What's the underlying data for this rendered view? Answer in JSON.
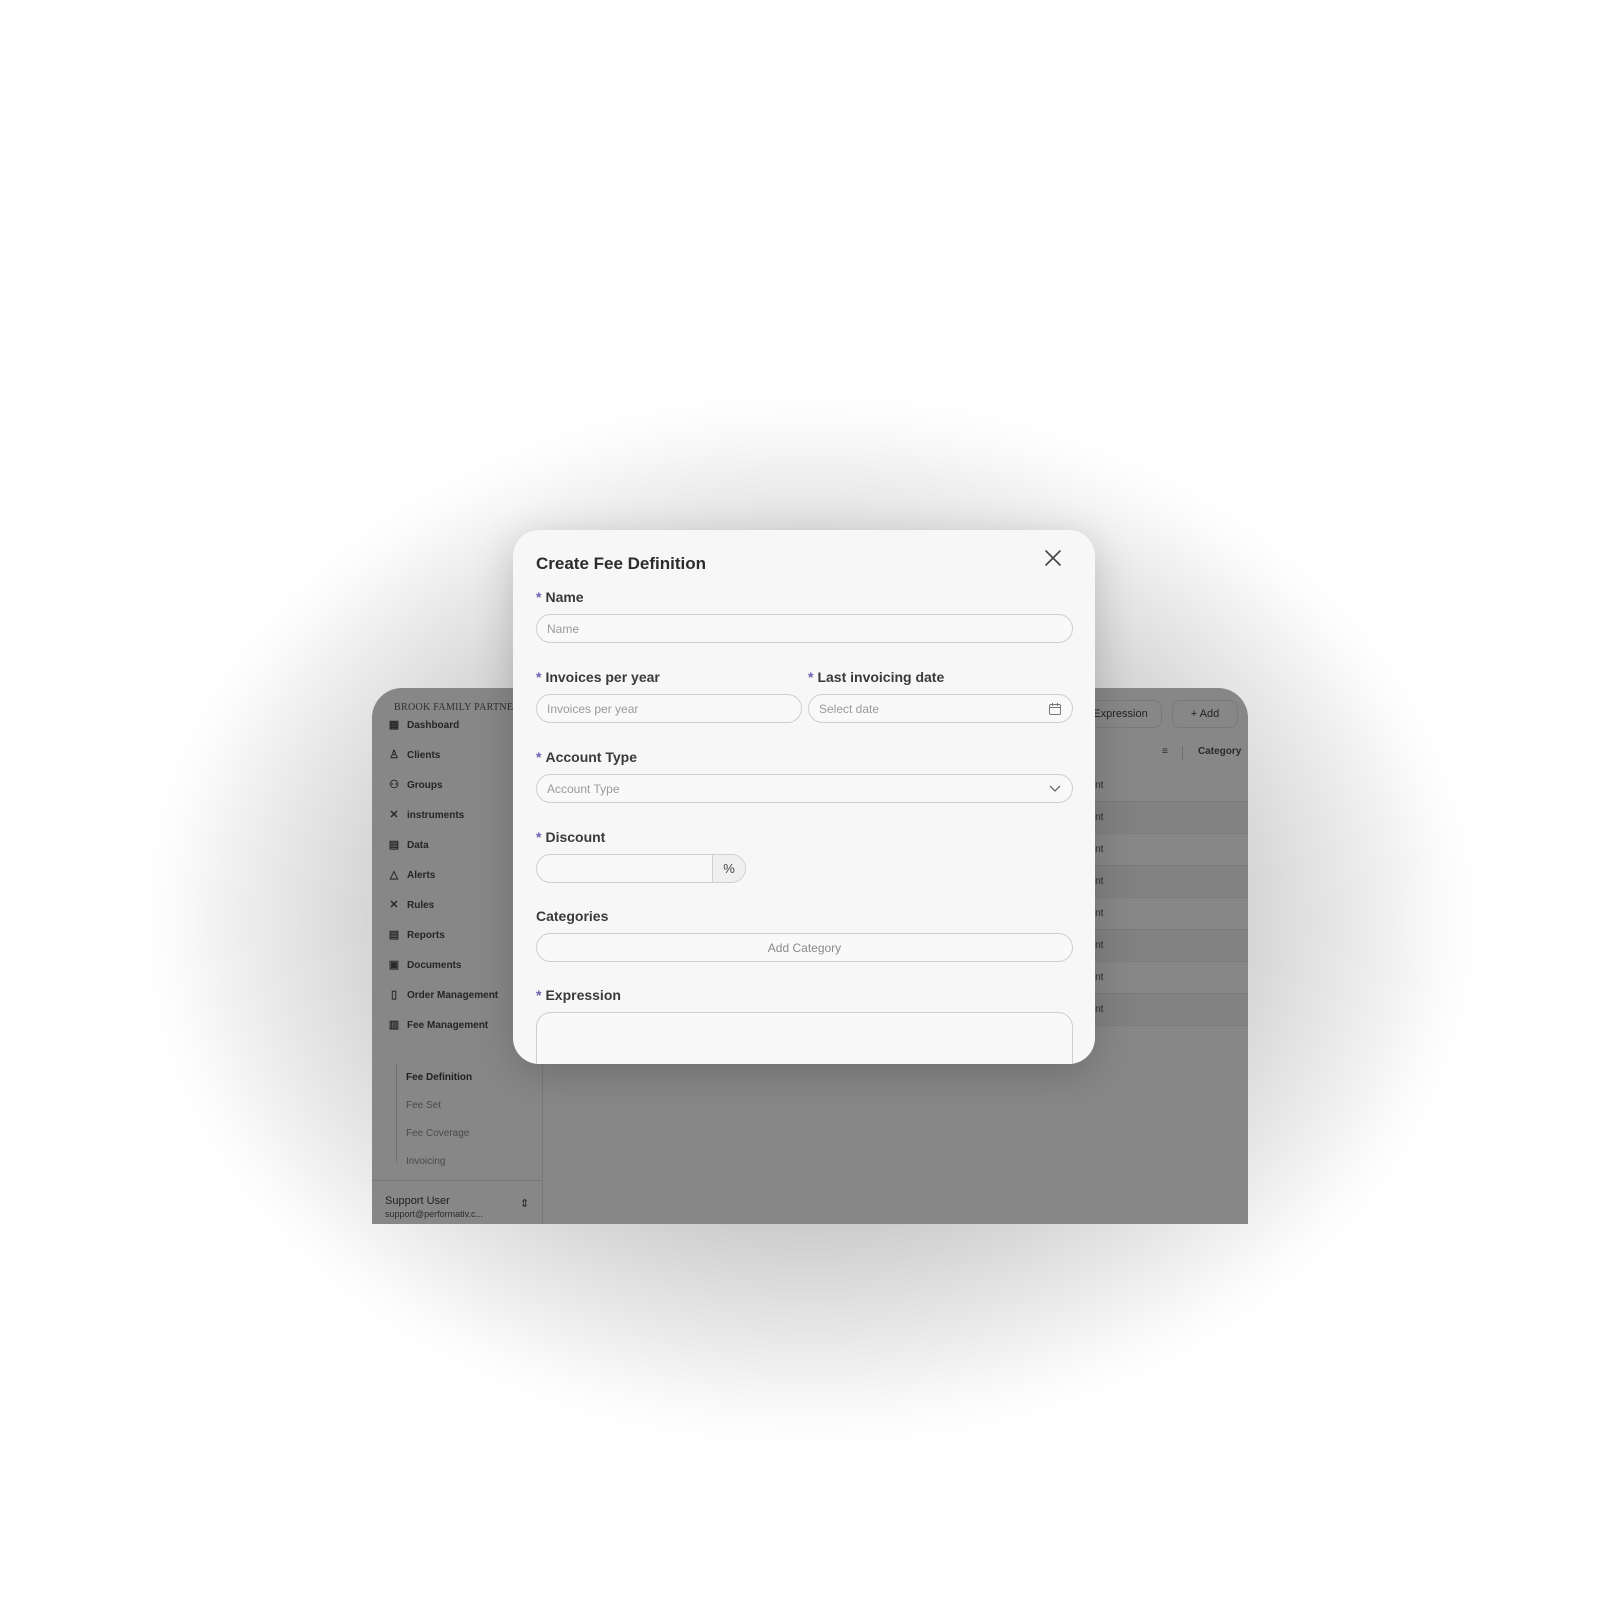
{
  "app": {
    "brand": "BROOK FAMILY PARTNERS",
    "nav": [
      {
        "label": "Dashboard",
        "icon": "dashboard-icon"
      },
      {
        "label": "Clients",
        "icon": "user-icon"
      },
      {
        "label": "Groups",
        "icon": "users-icon"
      },
      {
        "label": "instruments",
        "icon": "tools-icon"
      },
      {
        "label": "Data",
        "icon": "database-icon"
      },
      {
        "label": "Alerts",
        "icon": "warning-icon"
      },
      {
        "label": "Rules",
        "icon": "rules-icon"
      },
      {
        "label": "Reports",
        "icon": "report-icon"
      },
      {
        "label": "Documents",
        "icon": "documents-icon"
      },
      {
        "label": "Order Management",
        "icon": "order-icon"
      },
      {
        "label": "Fee Management",
        "icon": "fee-icon"
      }
    ],
    "subnav": [
      "Fee Definition",
      "Fee Set",
      "Fee Coverage",
      "Invoicing"
    ],
    "user": {
      "name": "Support User",
      "email": "support@performativ.c..."
    },
    "toolbar": {
      "expression": "Expression",
      "add": "+ Add"
    },
    "table": {
      "header": "Category",
      "rows": [
        "ount",
        "ount",
        "ount",
        "ount",
        "ount",
        "ount",
        "ount",
        "ount"
      ]
    }
  },
  "modal": {
    "title": "Create Fee Definition",
    "name_label": "Name",
    "name_placeholder": "Name",
    "invoices_label": "Invoices per year",
    "invoices_placeholder": "Invoices per year",
    "last_date_label": "Last invoicing date",
    "last_date_placeholder": "Select date",
    "account_type_label": "Account Type",
    "account_type_placeholder": "Account Type",
    "discount_label": "Discount",
    "discount_suffix": "%",
    "categories_label": "Categories",
    "add_category": "Add Category",
    "expression_label": "Expression",
    "required_mark": "*"
  },
  "colors": {
    "required": "#6b5fb0",
    "overlay": "#878787"
  }
}
